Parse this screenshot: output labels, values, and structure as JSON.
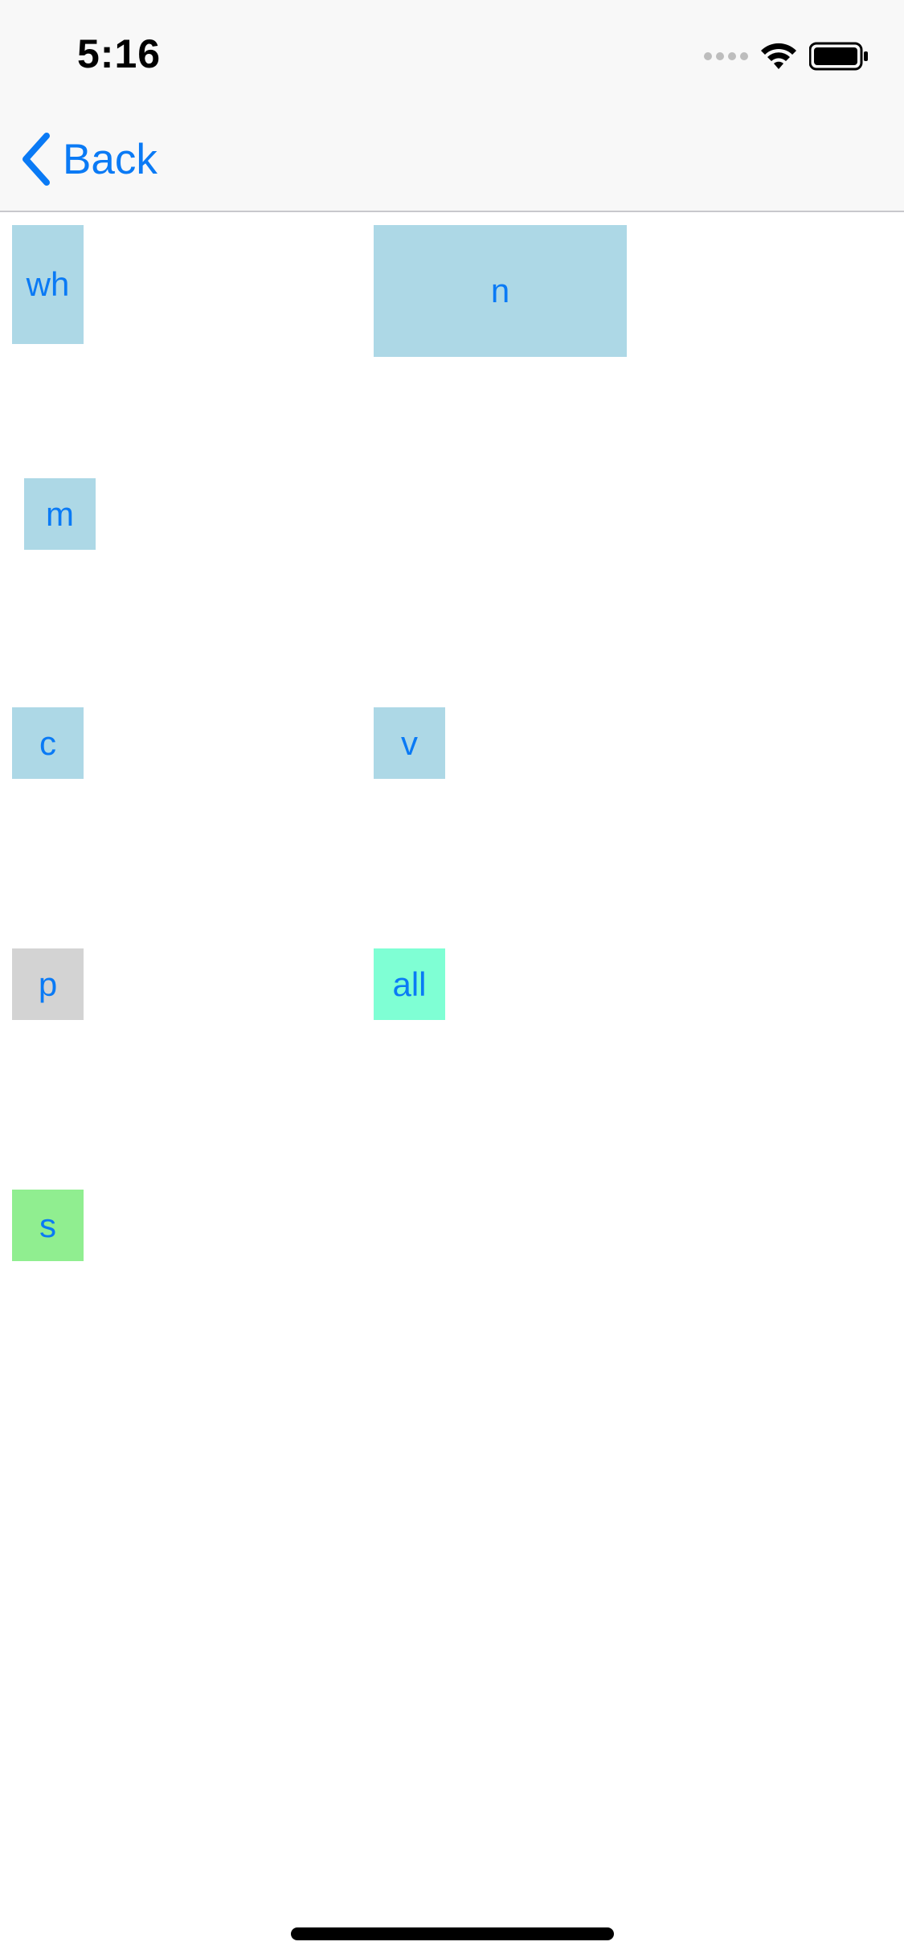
{
  "status_bar": {
    "time": "5:16",
    "icons": [
      "signal-dots-icon",
      "wifi-icon",
      "battery-icon"
    ]
  },
  "nav": {
    "back_label": "Back",
    "back_icon": "chevron-left-icon"
  },
  "tiles": {
    "wh": {
      "label": "wh",
      "color": "#add8e6"
    },
    "n": {
      "label": "n",
      "color": "#add8e6"
    },
    "m": {
      "label": "m",
      "color": "#add8e6"
    },
    "c": {
      "label": "c",
      "color": "#add8e6"
    },
    "v": {
      "label": "v",
      "color": "#add8e6"
    },
    "p": {
      "label": "p",
      "color": "#d3d3d3"
    },
    "all": {
      "label": "all",
      "color": "#7fffd4"
    },
    "s": {
      "label": "s",
      "color": "#90ee90"
    }
  },
  "theme": {
    "accent": "#0a7af5",
    "nav_background": "#f8f8f8",
    "page_background": "#ffffff"
  }
}
